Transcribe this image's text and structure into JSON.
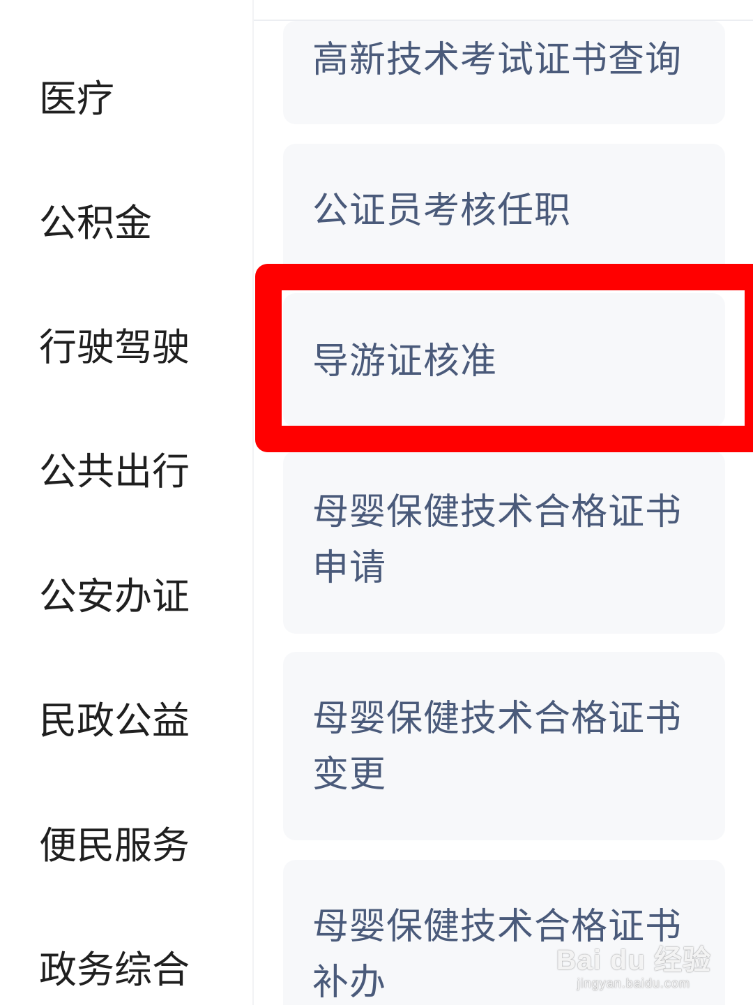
{
  "sidebar": {
    "items": [
      {
        "label": "医疗"
      },
      {
        "label": "公积金"
      },
      {
        "label": "行驶驾驶"
      },
      {
        "label": "公共出行"
      },
      {
        "label": "公安办证"
      },
      {
        "label": "民政公益"
      },
      {
        "label": "便民服务"
      },
      {
        "label": "政务综合"
      }
    ]
  },
  "services": {
    "items": [
      {
        "label": "高新技术考试证书查询"
      },
      {
        "label": "公证员考核任职"
      },
      {
        "label": "导游证核准"
      },
      {
        "label": "母婴保健技术合格证书申请"
      },
      {
        "label": "母婴保健技术合格证书变更"
      },
      {
        "label": "母婴保健技术合格证书补办"
      }
    ]
  },
  "highlight": {
    "color": "#ff0000",
    "target": "导游证核准"
  },
  "watermark": {
    "main": "Bai du 经验",
    "sub": "jingyan.baidu.com"
  },
  "colors": {
    "sidebar_text": "#1f1f1f",
    "card_text": "#4a5a7a",
    "card_bg": "#f7f8fa"
  }
}
